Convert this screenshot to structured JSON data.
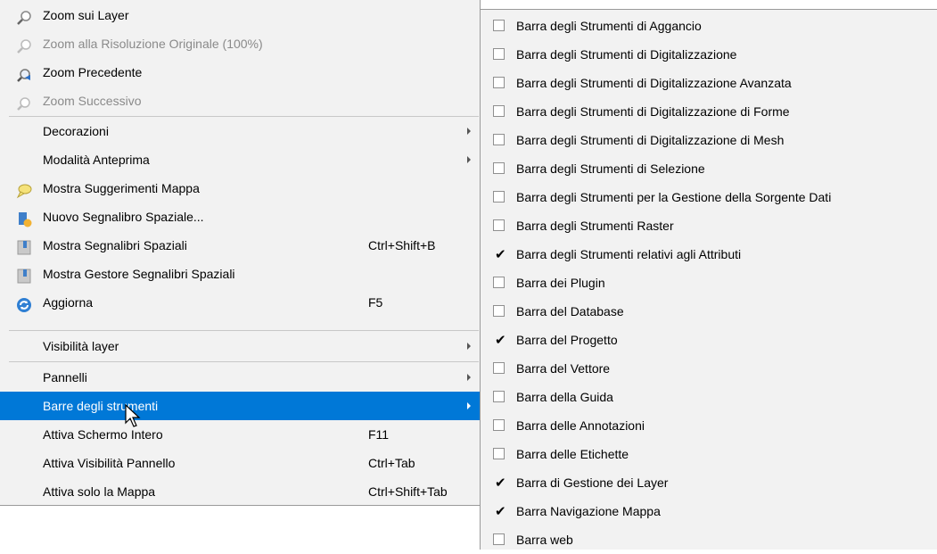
{
  "main_menu": {
    "items": [
      {
        "label": "Zoom sui Layer",
        "shortcut": "",
        "icon": "zoom-layer-icon",
        "disabled": false,
        "submenu": false
      },
      {
        "label": "Zoom alla Risoluzione Originale (100%)",
        "shortcut": "",
        "icon": "zoom-native-resolution-icon",
        "disabled": true,
        "submenu": false
      },
      {
        "label": "Zoom Precedente",
        "shortcut": "",
        "icon": "zoom-previous-icon",
        "disabled": false,
        "submenu": false
      },
      {
        "label": "Zoom Successivo",
        "shortcut": "",
        "icon": "zoom-next-icon",
        "disabled": true,
        "submenu": false
      },
      {
        "label": "Decorazioni",
        "shortcut": "",
        "icon": "",
        "disabled": false,
        "submenu": true
      },
      {
        "label": "Modalità Anteprima",
        "shortcut": "",
        "icon": "",
        "disabled": false,
        "submenu": true
      },
      {
        "label": "Mostra Suggerimenti Mappa",
        "shortcut": "",
        "icon": "map-tips-icon",
        "disabled": false,
        "submenu": false
      },
      {
        "label": "Nuovo Segnalibro Spaziale...",
        "shortcut": "",
        "icon": "new-bookmark-icon",
        "disabled": false,
        "submenu": false
      },
      {
        "label": "Mostra Segnalibri Spaziali",
        "shortcut": "Ctrl+Shift+B",
        "icon": "bookmarks-icon",
        "disabled": false,
        "submenu": false
      },
      {
        "label": "Mostra Gestore Segnalibri Spaziali",
        "shortcut": "",
        "icon": "bookmark-manager-icon",
        "disabled": false,
        "submenu": false
      },
      {
        "label": "Aggiorna",
        "shortcut": "F5",
        "icon": "refresh-icon",
        "disabled": false,
        "submenu": false
      },
      {
        "label": "Visibilità layer",
        "shortcut": "",
        "icon": "",
        "disabled": false,
        "submenu": true
      },
      {
        "label": "Pannelli",
        "shortcut": "",
        "icon": "",
        "disabled": false,
        "submenu": true
      },
      {
        "label": "Barre degli strumenti",
        "shortcut": "",
        "icon": "",
        "disabled": false,
        "submenu": true,
        "highlighted": true
      },
      {
        "label": "Attiva Schermo Intero",
        "shortcut": "F11",
        "icon": "",
        "disabled": false,
        "submenu": false
      },
      {
        "label": "Attiva Visibilità Pannello",
        "shortcut": "Ctrl+Tab",
        "icon": "",
        "disabled": false,
        "submenu": false
      },
      {
        "label": "Attiva solo la Mappa",
        "shortcut": "Ctrl+Shift+Tab",
        "icon": "",
        "disabled": false,
        "submenu": false
      }
    ]
  },
  "toolbars_submenu": {
    "items": [
      {
        "label": "Barra degli Strumenti di Aggancio",
        "checked": false
      },
      {
        "label": "Barra degli Strumenti di Digitalizzazione",
        "checked": false
      },
      {
        "label": "Barra degli Strumenti di Digitalizzazione Avanzata",
        "checked": false
      },
      {
        "label": "Barra degli Strumenti di Digitalizzazione di Forme",
        "checked": false
      },
      {
        "label": "Barra degli Strumenti di Digitalizzazione di Mesh",
        "checked": false
      },
      {
        "label": "Barra degli Strumenti di Selezione",
        "checked": false
      },
      {
        "label": "Barra degli Strumenti per la Gestione della Sorgente Dati",
        "checked": false
      },
      {
        "label": "Barra degli Strumenti Raster",
        "checked": false
      },
      {
        "label": "Barra degli Strumenti relativi agli Attributi",
        "checked": true
      },
      {
        "label": "Barra dei Plugin",
        "checked": false
      },
      {
        "label": "Barra del Database",
        "checked": false
      },
      {
        "label": "Barra del Progetto",
        "checked": true
      },
      {
        "label": "Barra del Vettore",
        "checked": false
      },
      {
        "label": "Barra della Guida",
        "checked": false
      },
      {
        "label": "Barra delle Annotazioni",
        "checked": false
      },
      {
        "label": "Barra delle Etichette",
        "checked": false
      },
      {
        "label": "Barra di Gestione dei Layer",
        "checked": true
      },
      {
        "label": "Barra Navigazione Mappa",
        "checked": true
      },
      {
        "label": "Barra web",
        "checked": false
      }
    ]
  },
  "colors": {
    "highlight": "#0078d7",
    "menu_bg": "#f2f2f2",
    "disabled_text": "#8a8a8a"
  }
}
